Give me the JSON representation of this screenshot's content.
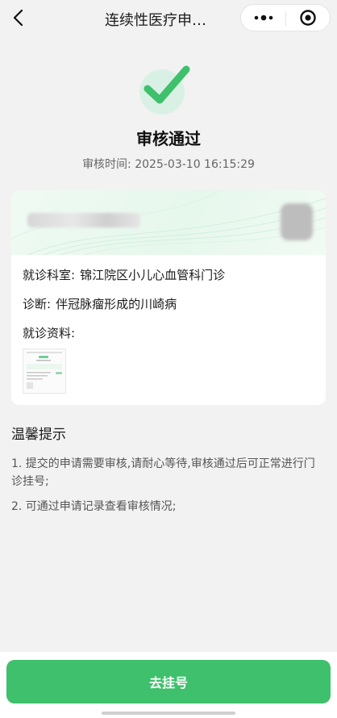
{
  "header": {
    "back_icon": "chevron-left-icon",
    "title": "连续性医疗申…",
    "more_icon": "more-dots-icon",
    "close_icon": "target-close-icon"
  },
  "status": {
    "icon": "check-icon",
    "title": "审核通过",
    "review_time_label": "审核时间:",
    "review_time": "2025-03-10 16:15:29",
    "accent_color": "#3ec06c"
  },
  "card": {
    "department_label": "就诊科室:",
    "department_value": "锦江院区小儿心血管科门诊",
    "diagnosis_label": "诊断:",
    "diagnosis_value": "伴冠脉瘤形成的川崎病",
    "materials_label": "就诊资料:"
  },
  "tips": {
    "title": "温馨提示",
    "items": [
      "1. 提交的申请需要审核,请耐心等待,审核通过后可正常进行门诊挂号;",
      "2. 可通过申请记录查看审核情况;"
    ]
  },
  "bottom": {
    "primary_button": "去挂号",
    "button_color": "#3ec06c"
  }
}
